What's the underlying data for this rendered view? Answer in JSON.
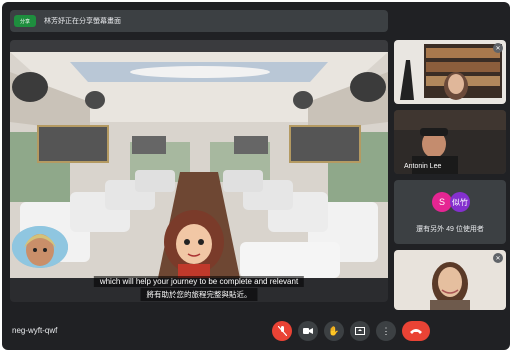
{
  "header": {
    "badge": "分享",
    "presenting_text": "林芳妤正在分享螢幕畫面"
  },
  "main": {
    "caption_en": "which will help your journey to be complete and relevant",
    "caption_zh": "將有助於您的旅程完整與貼近。"
  },
  "participants": [
    {
      "name": "",
      "muted": true
    },
    {
      "name": "Antonin Lee",
      "muted": false
    },
    {
      "name": "",
      "muted": true
    }
  ],
  "others": {
    "avatar_1": "S",
    "avatar_2": "似竹",
    "text": "還有另外 49 位使用者"
  },
  "footer": {
    "meeting_code": "neg-wyft-qwf"
  },
  "colors": {
    "accent_red": "#ea4335",
    "background": "#202124",
    "tile": "#3c4043"
  },
  "icons": {
    "mic": "mic-off-icon",
    "camera": "camera-icon",
    "hand": "raise-hand-icon",
    "present": "present-screen-icon",
    "more": "more-options-icon",
    "leave": "hang-up-icon"
  }
}
